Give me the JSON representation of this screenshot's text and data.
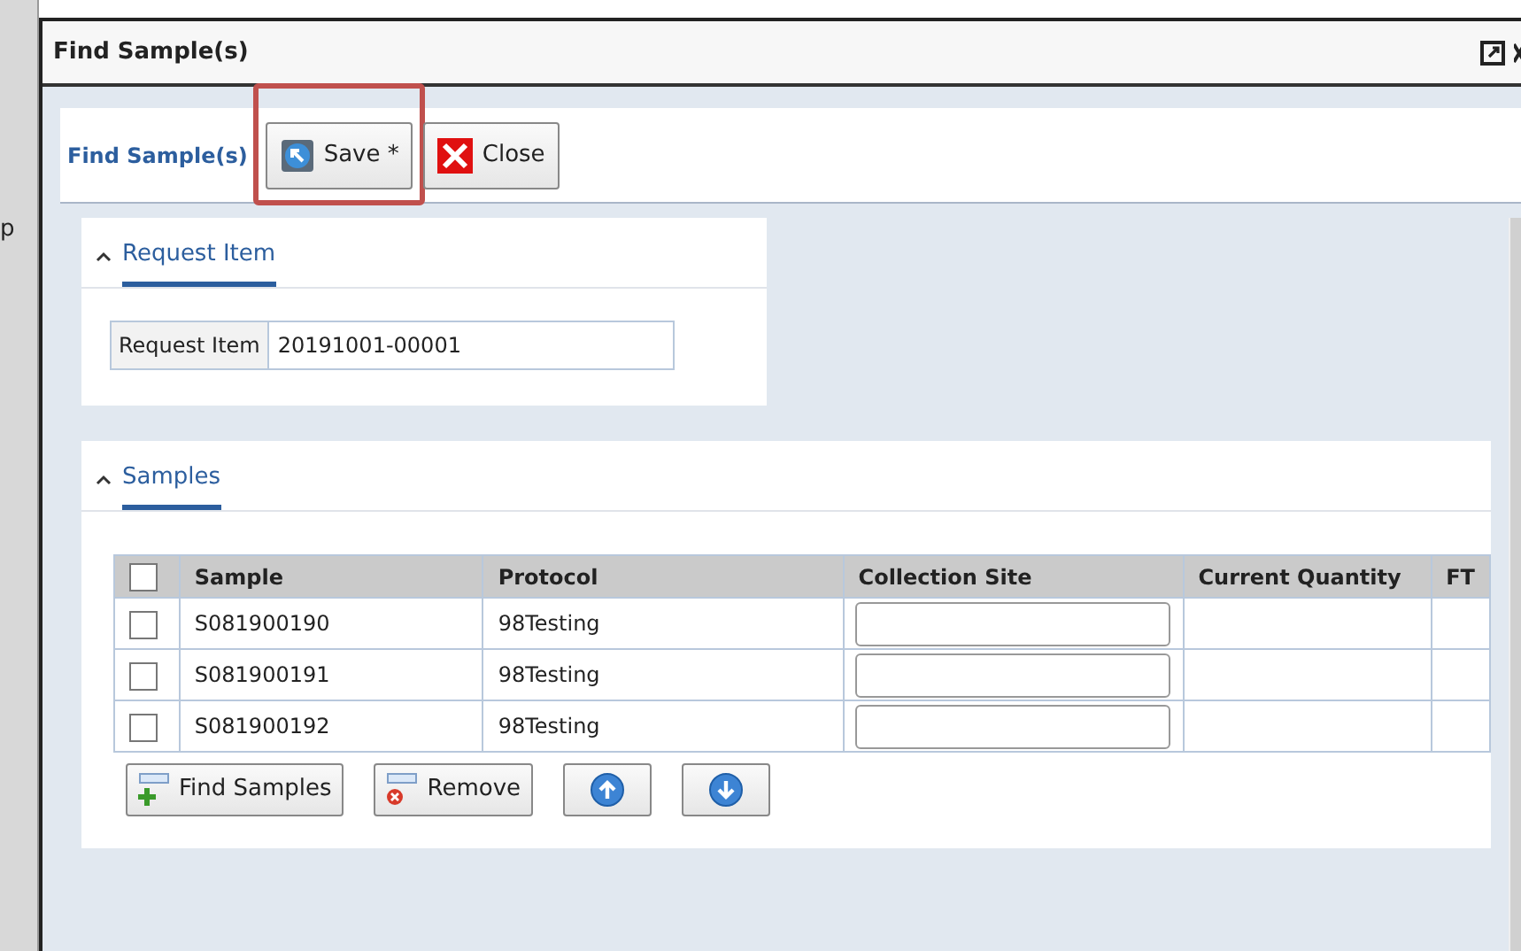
{
  "background_text": "p",
  "window": {
    "title": "Find Sample(s)"
  },
  "toolbar": {
    "title": "Find Sample(s)",
    "buttons": [
      {
        "label": "Save *",
        "kind": "save",
        "highlighted": true
      },
      {
        "label": "Close",
        "kind": "close",
        "highlighted": false
      }
    ]
  },
  "request_panel": {
    "title": "Request Item",
    "expanded": true,
    "field": {
      "label": "Request Item",
      "value": "20191001-00001"
    }
  },
  "samples_panel": {
    "title": "Samples",
    "expanded": true,
    "table": {
      "columns": [
        "Sample",
        "Protocol",
        "Collection Site",
        "Current Quantity",
        "FT"
      ],
      "select_all_checked": false,
      "rows": [
        {
          "checked": false,
          "sample": "S081900190",
          "protocol": "98Testing"
        },
        {
          "checked": false,
          "sample": "S081900191",
          "protocol": "98Testing"
        },
        {
          "checked": false,
          "sample": "S081900192",
          "protocol": "98Testing"
        }
      ]
    },
    "buttons": [
      {
        "label": "Find Samples",
        "kind": "add"
      },
      {
        "label": "Remove",
        "kind": "remove"
      },
      {
        "kind": "up"
      },
      {
        "kind": "down"
      }
    ]
  }
}
